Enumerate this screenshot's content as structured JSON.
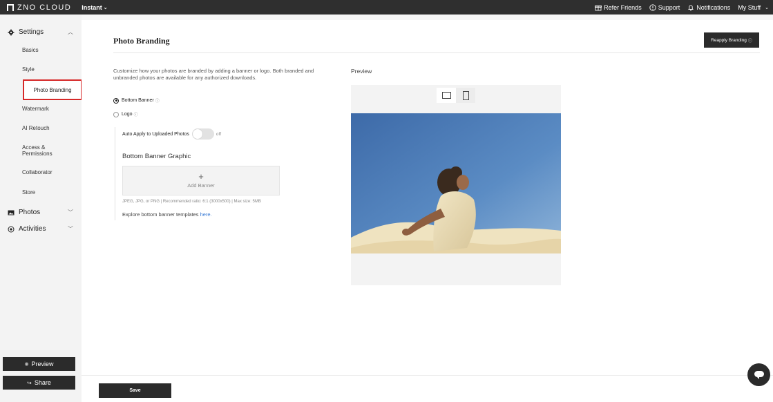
{
  "brand": {
    "name": "ZNO CLOUD",
    "plan": "Instant"
  },
  "topnav": {
    "refer": "Refer Friends",
    "support": "Support",
    "notifications": "Notifications",
    "my_stuff": "My Stuff"
  },
  "sidebar": {
    "settings_label": "Settings",
    "items": [
      {
        "label": "Basics"
      },
      {
        "label": "Style"
      },
      {
        "label": "Photo Branding"
      },
      {
        "label": "Watermark"
      },
      {
        "label": "AI Retouch"
      },
      {
        "label": "Access &"
      },
      {
        "label": "Permissions"
      },
      {
        "label": "Collaborator"
      },
      {
        "label": "Store"
      }
    ],
    "photos_label": "Photos",
    "activities_label": "Activities",
    "preview_label": "Preview",
    "share_label": "Share"
  },
  "main": {
    "title": "Photo Branding",
    "reapply_label": "Reapply Branding",
    "description": "Customize how your photos are branded by adding a banner or logo. Both branded and unbranded photos are available for any authorized downloads.",
    "preview_label": "Preview",
    "option_bottom_banner": "Bottom Banner",
    "option_logo": "Logo",
    "auto_apply_label": "Auto Apply to Uploaded Photos",
    "auto_apply_state": "off",
    "banner_section_title": "Bottom Banner Graphic",
    "add_banner_label": "Add Banner",
    "hint": "JPEG, JPG, or PNG | Recommended ratio: 6:1 (3000x500) | Max size: 5MB",
    "explore_text": "Explore bottom banner templates",
    "explore_link": "here.",
    "save_label": "Save"
  }
}
